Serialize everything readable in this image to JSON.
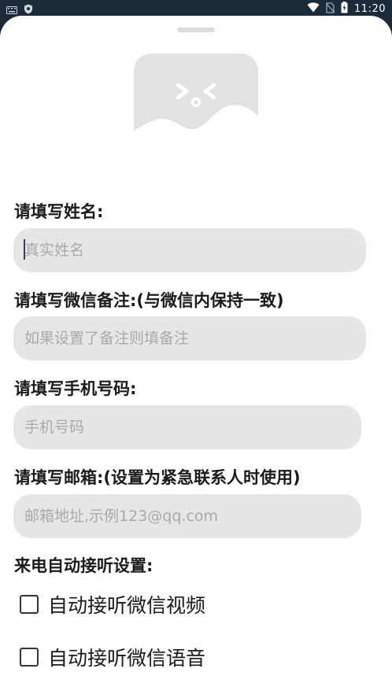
{
  "status_bar": {
    "time": "11:20",
    "icons": [
      "keyboard-icon",
      "shield-icon",
      "wifi-icon",
      "sim-off-icon",
      "battery-charging-icon"
    ]
  },
  "form": {
    "name": {
      "label": "请填写姓名:",
      "placeholder": "真实姓名",
      "value": ""
    },
    "wechat_note": {
      "label": "请填写微信备注:(与微信内保持一致)",
      "placeholder": "如果设置了备注则填备注",
      "value": ""
    },
    "phone": {
      "label": "请填写手机号码:",
      "placeholder": "手机号码",
      "value": ""
    },
    "email": {
      "label": "请填写邮箱:(设置为紧急联系人时使用)",
      "placeholder": "邮箱地址,示例123@qq.com",
      "value": ""
    },
    "auto_answer": {
      "label": "来电自动接听设置:",
      "options": [
        {
          "label": "自动接听微信视频",
          "checked": false
        },
        {
          "label": "自动接听微信语音",
          "checked": false
        }
      ]
    }
  }
}
